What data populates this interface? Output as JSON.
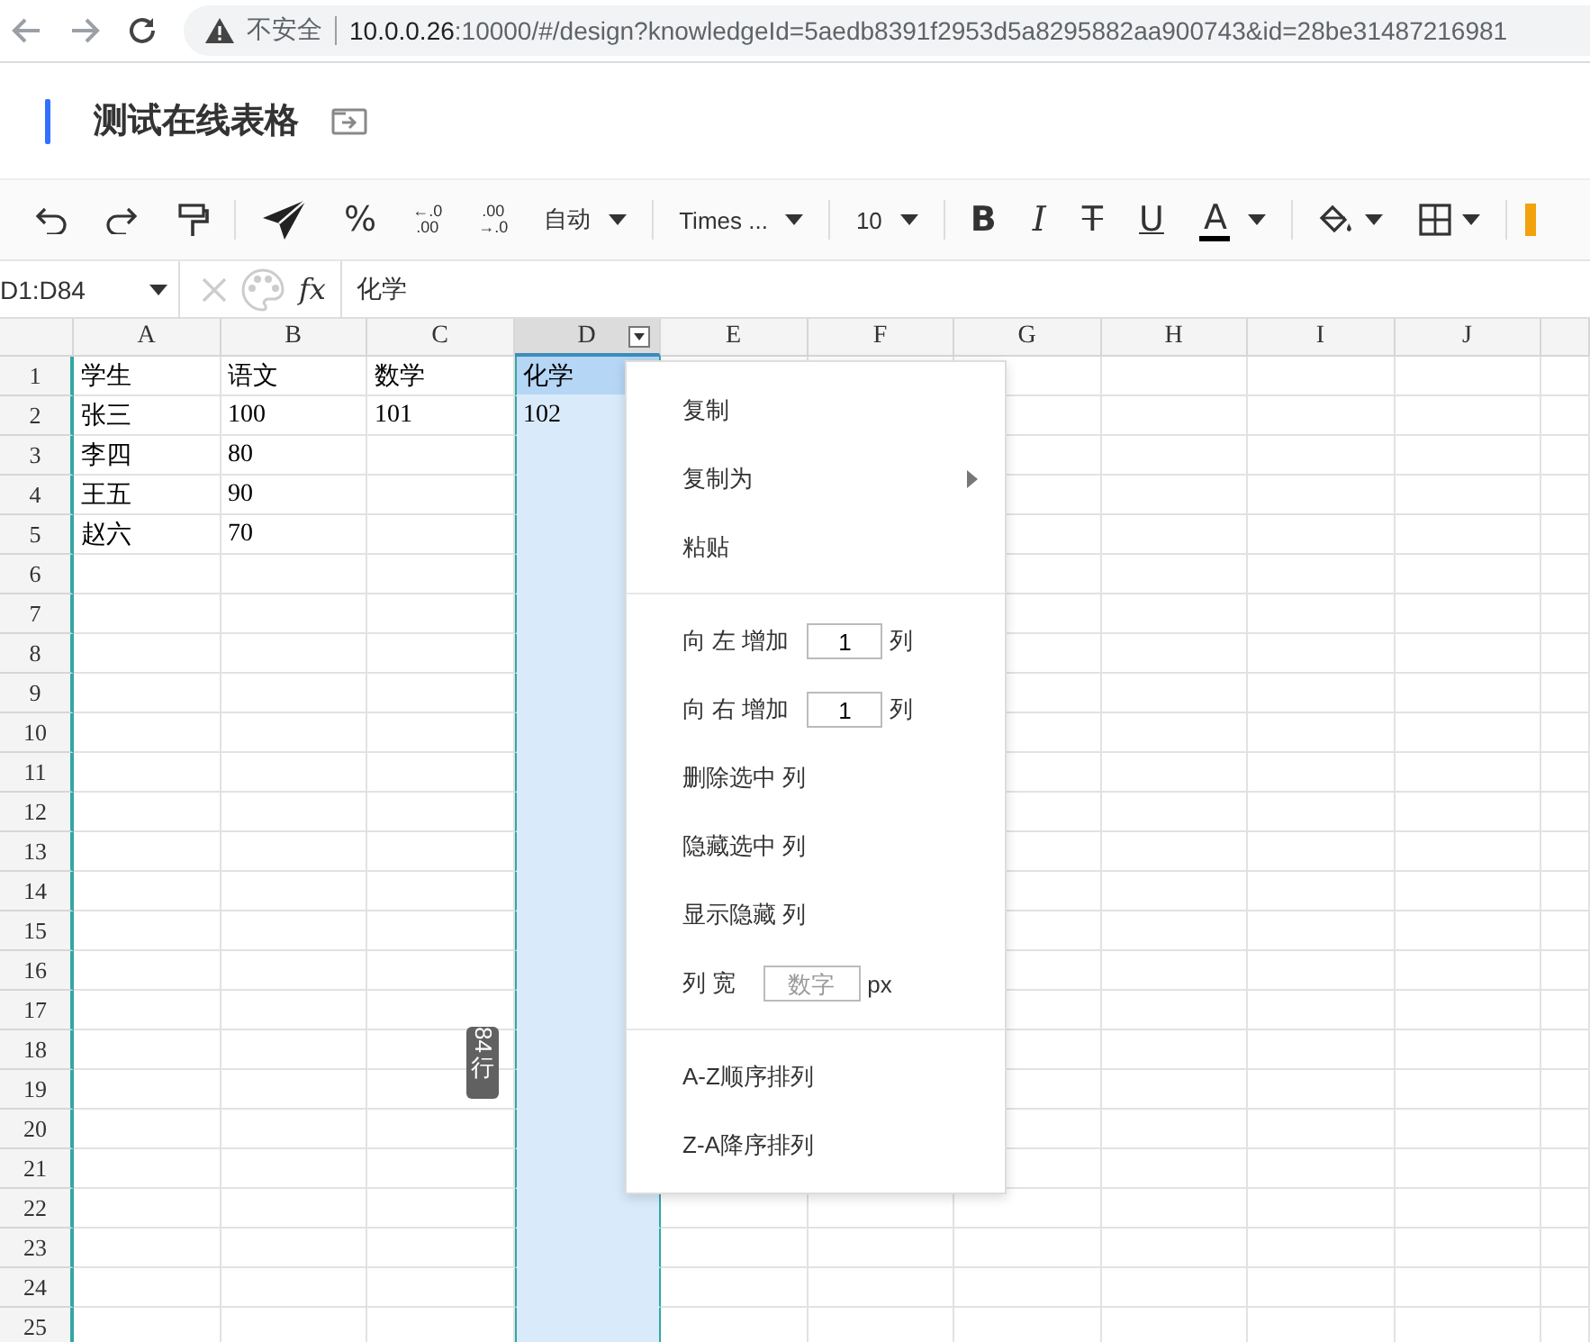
{
  "browser": {
    "security": "不安全",
    "url_host": "10.0.0.26",
    "url_rest": ":10000/#/design?knowledgeId=5aedb8391f2953d5a8295882aa900743&id=28be31487216981"
  },
  "header": {
    "title": "测试在线表格"
  },
  "toolbar": [
    {
      "kind": "undo"
    },
    {
      "kind": "redo"
    },
    {
      "kind": "painter"
    },
    {
      "kind": "divider"
    },
    {
      "kind": "send"
    },
    {
      "kind": "glyph",
      "text": "%"
    },
    {
      "kind": "decimal",
      "top": "←.0",
      "bottom": ".00"
    },
    {
      "kind": "decimal",
      "top": ".00",
      "bottom": "→.0"
    },
    {
      "kind": "dropdown",
      "text": "自动"
    },
    {
      "kind": "divider"
    },
    {
      "kind": "dropdown",
      "text": "Times ..."
    },
    {
      "kind": "divider"
    },
    {
      "kind": "dropdown",
      "text": "10"
    },
    {
      "kind": "divider"
    },
    {
      "kind": "bold",
      "text": "B"
    },
    {
      "kind": "italic",
      "text": "I"
    },
    {
      "kind": "strike",
      "text": "T"
    },
    {
      "kind": "underline",
      "text": "U"
    },
    {
      "kind": "fontcolor",
      "text": "A"
    },
    {
      "kind": "divider"
    },
    {
      "kind": "fill"
    },
    {
      "kind": "borders"
    },
    {
      "kind": "divider"
    },
    {
      "kind": "cutoff"
    }
  ],
  "formula_bar": {
    "range": "D1:D84",
    "fx": "fx",
    "value": "化学"
  },
  "grid": {
    "columns": [
      {
        "label": "A",
        "selected": false
      },
      {
        "label": "B",
        "selected": false
      },
      {
        "label": "C",
        "selected": false
      },
      {
        "label": "D",
        "selected": true
      },
      {
        "label": "E",
        "selected": false
      },
      {
        "label": "F",
        "selected": false
      },
      {
        "label": "G",
        "selected": false
      },
      {
        "label": "H",
        "selected": false
      },
      {
        "label": "I",
        "selected": false
      },
      {
        "label": "J",
        "selected": false
      }
    ],
    "rows": [
      {
        "number": "1",
        "cells": [
          "学生",
          "语文",
          "数学",
          "化学"
        ]
      },
      {
        "number": "2",
        "cells": [
          "张三",
          "100",
          "101",
          "102"
        ]
      },
      {
        "number": "3",
        "cells": [
          "李四",
          "80"
        ]
      },
      {
        "number": "4",
        "cells": [
          "王五",
          "90"
        ]
      },
      {
        "number": "5",
        "cells": [
          "赵六",
          "70"
        ]
      },
      {
        "number": "6"
      },
      {
        "number": "7"
      },
      {
        "number": "8"
      },
      {
        "number": "9"
      },
      {
        "number": "10"
      },
      {
        "number": "11"
      },
      {
        "number": "12"
      },
      {
        "number": "13"
      },
      {
        "number": "14"
      },
      {
        "number": "15"
      },
      {
        "number": "16"
      },
      {
        "number": "17"
      },
      {
        "number": "18"
      },
      {
        "number": "19"
      },
      {
        "number": "20"
      },
      {
        "number": "21"
      },
      {
        "number": "22"
      },
      {
        "number": "23"
      },
      {
        "number": "24"
      },
      {
        "number": "25"
      }
    ]
  },
  "row_tip": {
    "count": "84",
    "unit": "行"
  },
  "context_menu": [
    {
      "kind": "item",
      "label": "复制"
    },
    {
      "kind": "submenu",
      "label": "复制为"
    },
    {
      "kind": "item",
      "label": "粘贴"
    },
    {
      "kind": "separator"
    },
    {
      "kind": "count",
      "label": "向 左 增加",
      "value": "1",
      "suffix": "列"
    },
    {
      "kind": "count",
      "label": "向 右 增加",
      "value": "1",
      "suffix": "列"
    },
    {
      "kind": "item",
      "label": "删除选中 列"
    },
    {
      "kind": "item",
      "label": "隐藏选中 列"
    },
    {
      "kind": "item",
      "label": "显示隐藏 列"
    },
    {
      "kind": "width",
      "label": "列 宽",
      "placeholder": "数字",
      "suffix": "px"
    },
    {
      "kind": "separator"
    },
    {
      "kind": "item",
      "label": "A-Z顺序排列"
    },
    {
      "kind": "item",
      "label": "Z-A降序排列"
    }
  ]
}
